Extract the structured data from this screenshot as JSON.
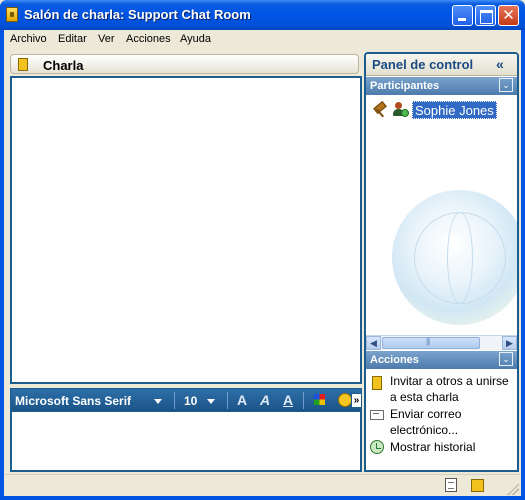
{
  "window": {
    "title": "Salón de charla: Support Chat Room"
  },
  "menu": [
    "Archivo",
    "Editar",
    "Ver",
    "Acciones",
    "Ayuda"
  ],
  "chat": {
    "title": "Charla",
    "font_name": "Microsoft Sans Serif",
    "font_size": "10",
    "bold_label": "A",
    "italic_label": "A",
    "underline_label": "A",
    "more_label": "»"
  },
  "panel": {
    "title": "Panel de control",
    "collapse_glyph": "«",
    "participants": {
      "title": "Participantes",
      "toggle": "⌄",
      "items": [
        {
          "name": "Sophie Jones",
          "icons": [
            "hammer-icon",
            "user-icon"
          ]
        }
      ]
    },
    "actions": {
      "title": "Acciones",
      "toggle": "⌄",
      "items": [
        {
          "label": "Invitar a otros a unirse a esta charla",
          "icon": "invite-icon"
        },
        {
          "label": "Enviar correo electrónico...",
          "icon": "email-icon"
        },
        {
          "label": "Mostrar historial",
          "icon": "history-icon"
        }
      ]
    }
  },
  "colors": {
    "titlebar": "#0054e3",
    "frame": "#1b5d8e",
    "selection": "#316ac5",
    "panel_title": "#1b4b84"
  }
}
